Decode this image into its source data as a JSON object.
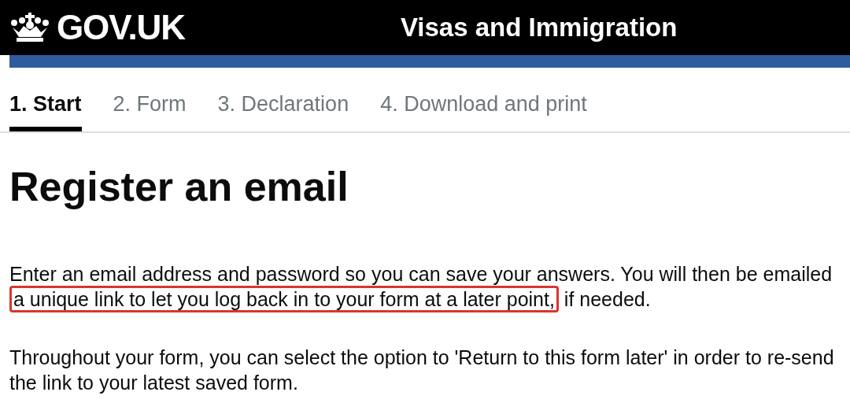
{
  "header": {
    "logo": "GOV.UK",
    "service": "Visas and Immigration"
  },
  "steps": [
    {
      "label": "1. Start",
      "selected": true
    },
    {
      "label": "2. Form",
      "selected": false
    },
    {
      "label": "3. Declaration",
      "selected": false
    },
    {
      "label": "4. Download and print",
      "selected": false
    }
  ],
  "heading": "Register an email",
  "paragraphs": [
    {
      "before": "Enter an email address and password so you can save your answers. You will then be emailed",
      "highlight": "a unique link to let you log back in to your form at a later point,",
      "after": "if needed."
    },
    {
      "before": "Throughout your form, you can select the option to 'Return to this form later' in order to re-send the link to your latest saved form."
    }
  ]
}
